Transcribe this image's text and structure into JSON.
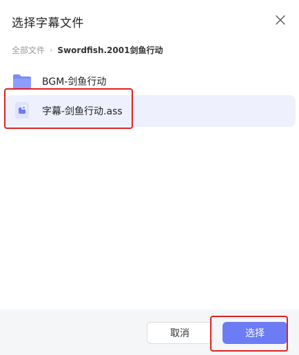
{
  "dialog": {
    "title": "选择字幕文件",
    "close_icon": "close-icon"
  },
  "breadcrumb": {
    "root": "全部文件",
    "separator": "›",
    "current": "Swordfish.2001剑鱼行动"
  },
  "files": [
    {
      "name": "BGM-剑鱼行动",
      "type": "folder",
      "icon": "folder-icon",
      "selected": false
    },
    {
      "name": "字幕-剑鱼行动.ass",
      "type": "subtitle",
      "icon": "subtitle-file-icon",
      "selected": true
    }
  ],
  "footer": {
    "cancel_label": "取消",
    "select_label": "选择"
  },
  "colors": {
    "accent": "#6b7cf5",
    "selected_row": "#eef0fd",
    "folder": "#7b8cf7",
    "highlight_box": "#e02020",
    "footer_bg": "#f5f6f8"
  }
}
